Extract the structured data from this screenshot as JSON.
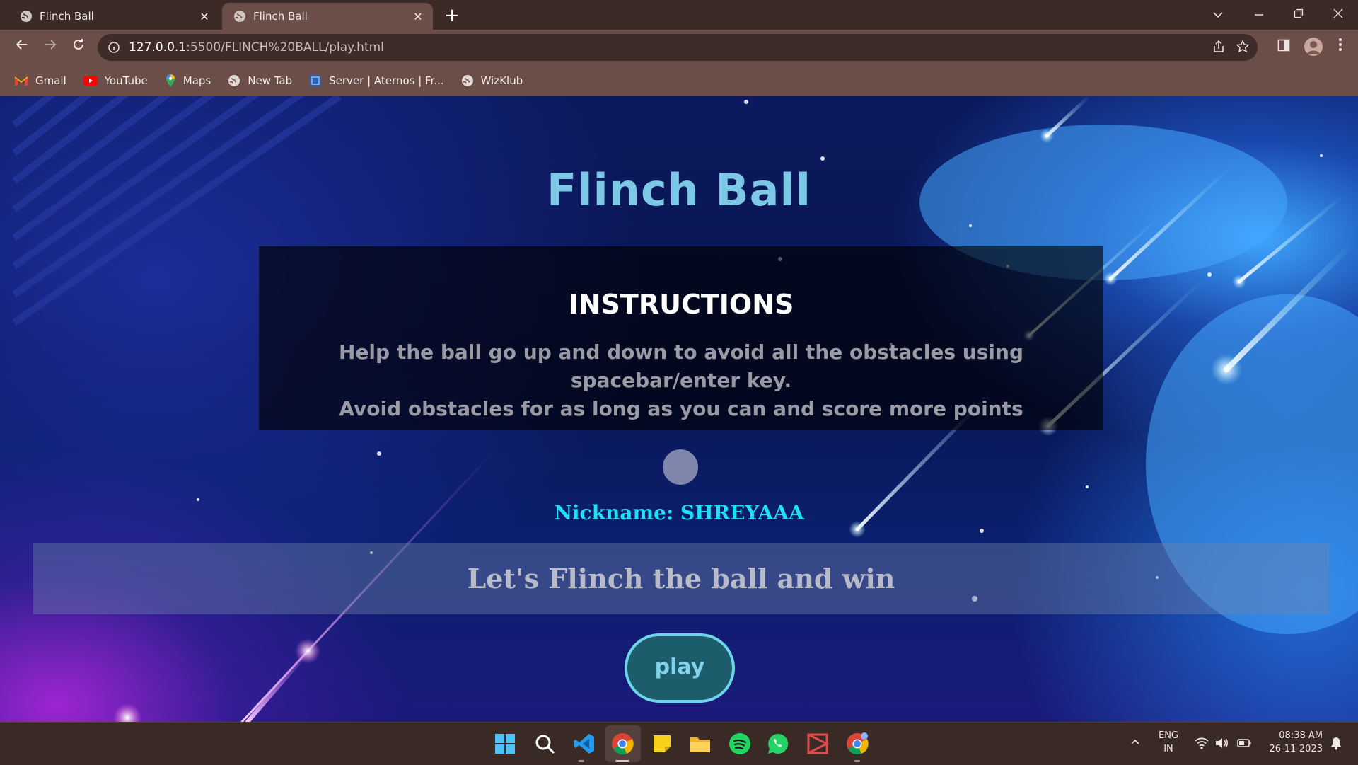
{
  "browser": {
    "tabs": [
      {
        "title": "Flinch Ball",
        "active": false
      },
      {
        "title": "Flinch Ball",
        "active": true
      }
    ],
    "new_tab_symbol": "+",
    "address": {
      "host": "127.0.0.1",
      "path": ":5500/FLINCH%20BALL/play.html"
    },
    "bookmarks": [
      {
        "label": "Gmail",
        "icon": "gmail-icon"
      },
      {
        "label": "YouTube",
        "icon": "youtube-icon"
      },
      {
        "label": "Maps",
        "icon": "maps-icon"
      },
      {
        "label": "New Tab",
        "icon": "globe-icon"
      },
      {
        "label": "Server | Aternos | Fr...",
        "icon": "aternos-icon"
      },
      {
        "label": "WizKlub",
        "icon": "globe-icon"
      }
    ]
  },
  "page": {
    "title": "Flinch Ball",
    "instructions": {
      "heading": "INSTRUCTIONS",
      "line1": "Help the ball go up and down to avoid all the obstacles using spacebar/enter key.",
      "line2": "Avoid obstacles for as long as you can and score more points"
    },
    "nickname": "Nickname: SHREYAAA",
    "tagline": "Let's Flinch the ball and win",
    "play_label": "play"
  },
  "taskbar": {
    "apps": [
      "windows-start-icon",
      "search-icon",
      "vscode-icon",
      "chrome-icon",
      "sticky-notes-icon",
      "file-explorer-icon",
      "spotify-icon",
      "whatsapp-icon",
      "app-icon",
      "chrome-profile-icon"
    ],
    "lang_line1": "ENG",
    "lang_line2": "IN",
    "time": "08:38 AM",
    "date": "26-11-2023"
  },
  "colors": {
    "chrome_dark": "#3b2a26",
    "chrome_light": "#6b4e47",
    "title": "#7cc8e6",
    "nickname": "#1fe0f5",
    "play_border": "#6fd5ea",
    "play_fill": "#1d5c6b"
  }
}
